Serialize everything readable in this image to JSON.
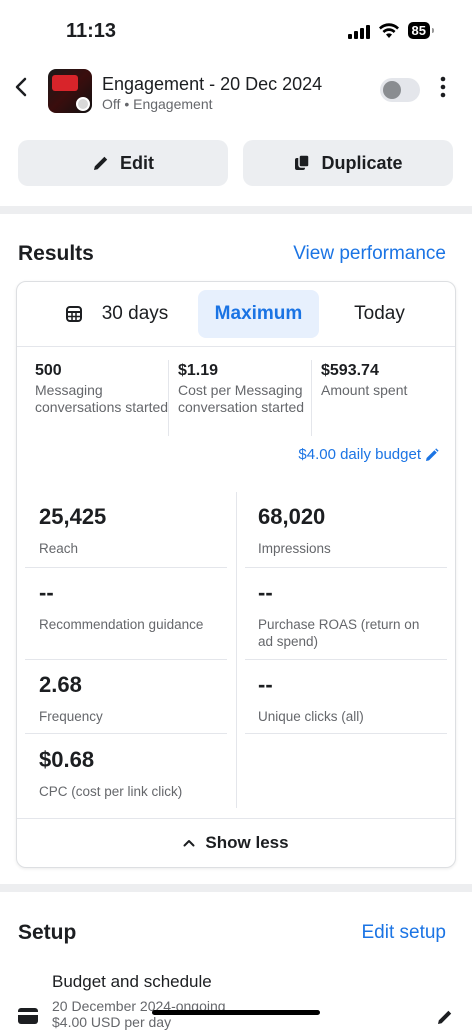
{
  "status_bar": {
    "time": "11:13",
    "battery": "85"
  },
  "header": {
    "title": "Engagement - 20 Dec 2024",
    "status": "Off",
    "separator": "•",
    "objective": "Engagement",
    "toggle_on": false
  },
  "actions": {
    "edit_label": "Edit",
    "duplicate_label": "Duplicate"
  },
  "results": {
    "title": "Results",
    "view_performance": "View performance",
    "ranges": [
      "30 days",
      "Maximum",
      "Today"
    ],
    "selected_range": "Maximum",
    "top_metrics": [
      {
        "value": "500",
        "label": "Messaging conversations started"
      },
      {
        "value": "$1.19",
        "label": "Cost per Messaging conversation started"
      },
      {
        "value": "$593.74",
        "label": "Amount spent"
      }
    ],
    "daily_budget": "$4.00 daily budget",
    "metrics": [
      {
        "value": "25,425",
        "label": "Reach"
      },
      {
        "value": "68,020",
        "label": "Impressions"
      },
      {
        "value": "--",
        "label": "Recommendation guidance"
      },
      {
        "value": "--",
        "label": "Purchase ROAS (return on ad spend)"
      },
      {
        "value": "2.68",
        "label": "Frequency"
      },
      {
        "value": "--",
        "label": "Unique clicks (all)"
      },
      {
        "value": "$0.68",
        "label": "CPC (cost per link click)"
      }
    ],
    "show_less": "Show less"
  },
  "setup": {
    "title": "Setup",
    "edit_setup": "Edit setup",
    "item_title": "Budget and schedule",
    "item_dates": "20 December 2024-ongoing",
    "item_budget": "$4.00 USD per day"
  },
  "colors": {
    "accent": "#1b74e4",
    "selected_bg": "#e7f0fd",
    "button_bg": "#eceef1"
  },
  "icons": [
    "back-chevron-icon",
    "more-vertical-icon",
    "pencil-icon",
    "duplicate-icon",
    "calendar-icon",
    "chevron-up-icon",
    "credit-card-icon"
  ]
}
